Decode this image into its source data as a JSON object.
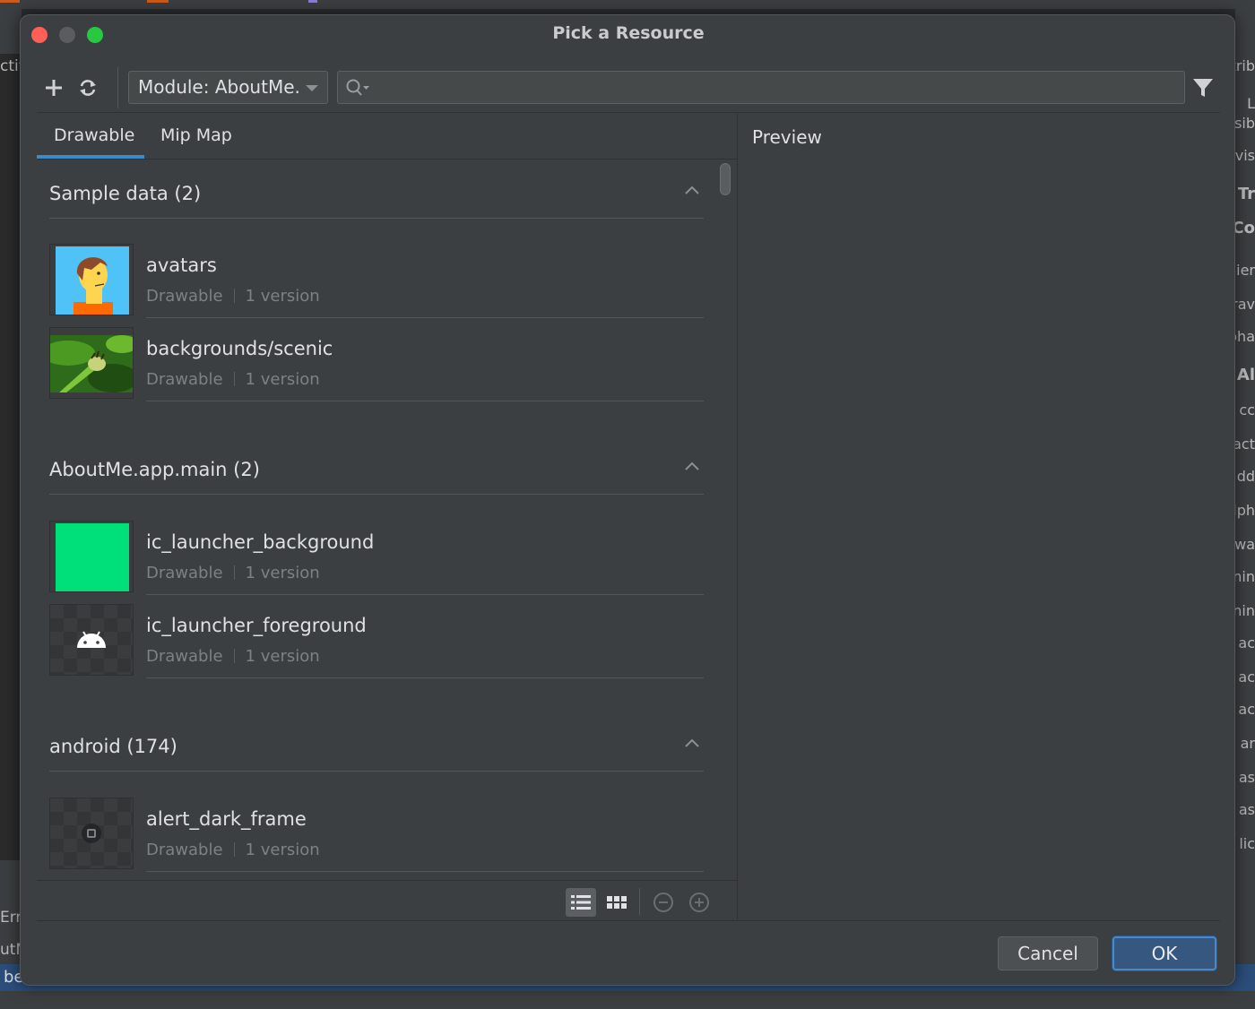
{
  "background": {
    "left_fragments": [
      "ctiv",
      "Err",
      "utN",
      "be"
    ],
    "right_fragments": [
      "trib",
      "L",
      "sib",
      "vis",
      "Tr",
      "Co",
      "ier",
      "rav",
      "pha",
      "Al",
      "cc",
      "act",
      "dd",
      "lph",
      "lwa",
      "nin",
      "nin",
      "ac",
      "ac",
      "ac",
      "ar",
      "as",
      "as",
      "lic"
    ]
  },
  "dialog": {
    "title": "Pick a Resource",
    "toolbar": {
      "add_icon": "plus-icon",
      "refresh_icon": "refresh-icon",
      "module_select_value": "Module: AboutMe.",
      "search_value": "",
      "filter_icon": "filter-icon"
    },
    "tabs": [
      {
        "label": "Drawable",
        "active": true
      },
      {
        "label": "Mip Map",
        "active": false
      }
    ],
    "sections": [
      {
        "title": "Sample data (2)",
        "items": [
          {
            "name": "avatars",
            "type": "Drawable",
            "versions": "1 version",
            "thumb": "avatar"
          },
          {
            "name": "backgrounds/scenic",
            "type": "Drawable",
            "versions": "1 version",
            "thumb": "scenic"
          }
        ]
      },
      {
        "title": "AboutMe.app.main (2)",
        "items": [
          {
            "name": "ic_launcher_background",
            "type": "Drawable",
            "versions": "1 version",
            "thumb": "green"
          },
          {
            "name": "ic_launcher_foreground",
            "type": "Drawable",
            "versions": "1 version",
            "thumb": "android"
          }
        ]
      },
      {
        "title": "android (174)",
        "items": [
          {
            "name": "alert_dark_frame",
            "type": "Drawable",
            "versions": "1 version",
            "thumb": "frame"
          }
        ]
      }
    ],
    "view_controls": {
      "list_view_icon": "list-view-icon",
      "grid_view_icon": "grid-view-icon",
      "zoom_out_icon": "zoom-out-icon",
      "zoom_in_icon": "zoom-in-icon",
      "active_view": "list"
    },
    "preview_label": "Preview",
    "buttons": {
      "cancel": "Cancel",
      "ok": "OK"
    },
    "colors": {
      "accent": "#3d8ac8",
      "ok_button": "#365880",
      "launcher_background": "#00e07a",
      "close": "#ff5f57",
      "maximize": "#28c840"
    }
  }
}
